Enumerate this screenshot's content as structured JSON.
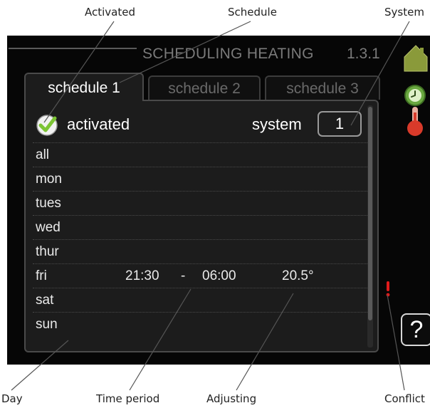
{
  "callouts": {
    "activated": "Activated",
    "schedule": "Schedule",
    "system": "System",
    "day": "Day",
    "time_period": "Time period",
    "adjusting": "Adjusting",
    "conflict": "Conflict"
  },
  "screen": {
    "title": "SCHEDULING HEATING",
    "menu_number": "1.3.1"
  },
  "tabs": [
    "schedule 1",
    "schedule 2",
    "schedule 3"
  ],
  "active_tab": "schedule 1",
  "activated": {
    "label": "activated",
    "checked": true
  },
  "system": {
    "label": "system",
    "value": "1"
  },
  "days": [
    {
      "name": "all"
    },
    {
      "name": "mon"
    },
    {
      "name": "tues"
    },
    {
      "name": "wed"
    },
    {
      "name": "thur"
    },
    {
      "name": "fri",
      "start": "21:30",
      "dash": "-",
      "end": "06:00",
      "temp": "20.5°"
    },
    {
      "name": "sat"
    },
    {
      "name": "sun"
    }
  ],
  "help": {
    "label": "?"
  },
  "icons": {
    "house": "house-icon",
    "clock": "clock-icon",
    "thermometer": "thermometer-icon",
    "check": "checkmark-icon",
    "conflict": "exclamation-icon",
    "help": "question-icon"
  },
  "colors": {
    "screen_bg": "#060606",
    "panel_bg": "#1c1c1c",
    "check_green": "#7cc434",
    "house_green": "#8a9a3a",
    "clock_green": "#6aa840",
    "thermo_red": "#d83a2a",
    "conflict_red": "#e11b1b"
  }
}
